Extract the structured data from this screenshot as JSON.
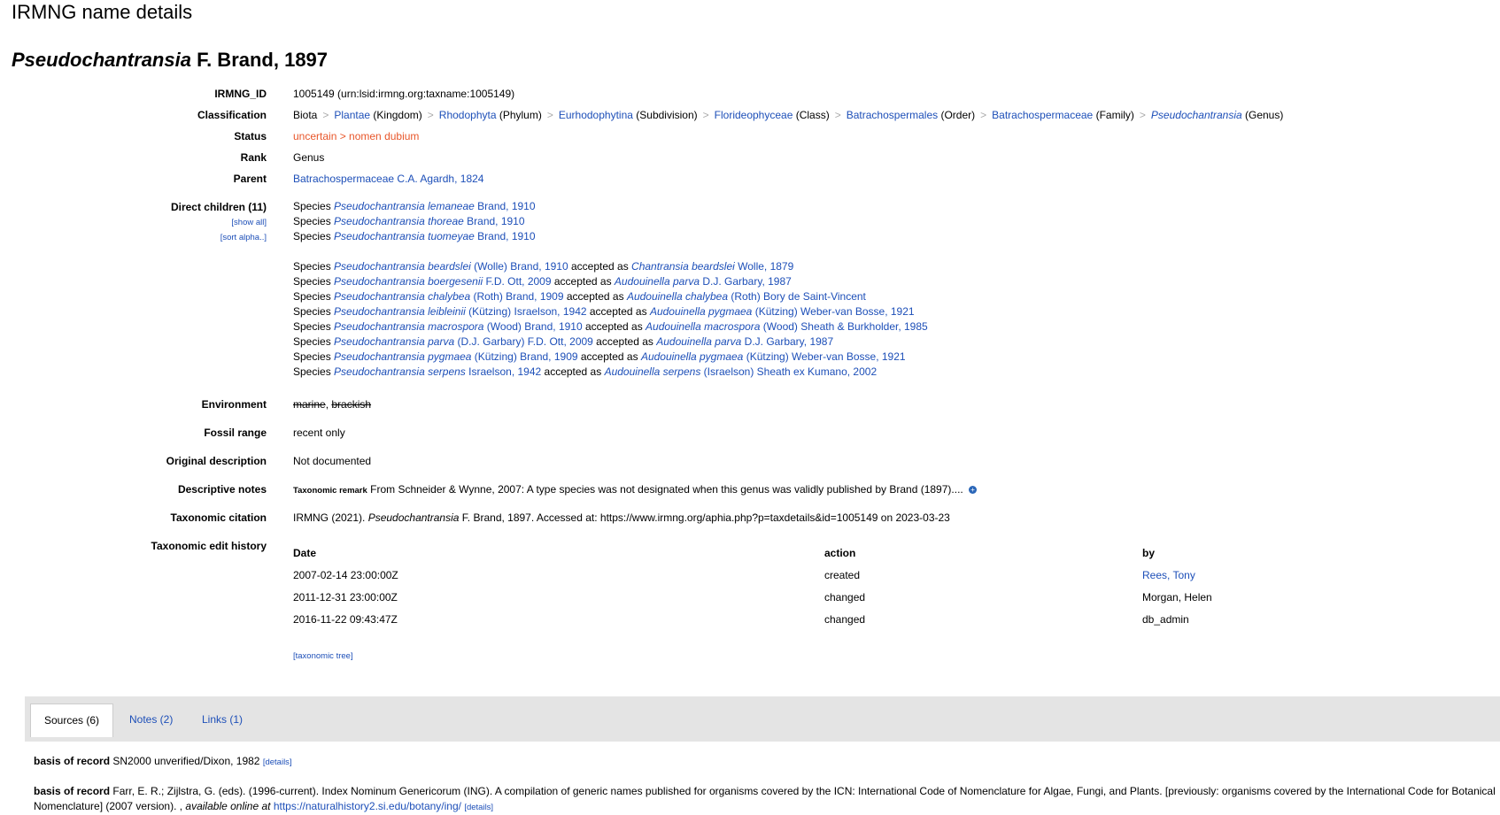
{
  "page_header": "IRMNG name details",
  "title": {
    "genus": "Pseudochantransia",
    "author": "F. Brand, 1897"
  },
  "irmng_id": {
    "label": "IRMNG_ID",
    "value": "1005149  (urn:lsid:irmng.org:taxname:1005149)"
  },
  "classification": {
    "label": "Classification",
    "items": [
      {
        "name": "Biota",
        "rank": "",
        "link": false
      },
      {
        "name": "Plantae",
        "rank": "(Kingdom)",
        "link": true
      },
      {
        "name": "Rhodophyta",
        "rank": "(Phylum)",
        "link": true
      },
      {
        "name": "Eurhodophytina",
        "rank": "(Subdivision)",
        "link": true
      },
      {
        "name": "Florideophyceae",
        "rank": "(Class)",
        "link": true
      },
      {
        "name": "Batrachospermales",
        "rank": "(Order)",
        "link": true
      },
      {
        "name": "Batrachospermaceae",
        "rank": "(Family)",
        "link": true
      },
      {
        "name": "Pseudochantransia",
        "rank": "(Genus)",
        "link": true,
        "italic": true
      }
    ],
    "separator": ">"
  },
  "status": {
    "label": "Status",
    "value": "uncertain > nomen dubium"
  },
  "rank": {
    "label": "Rank",
    "value": "Genus"
  },
  "parent": {
    "label": "Parent",
    "value": "Batrachospermaceae C.A. Agardh, 1824"
  },
  "children": {
    "label": "Direct children (11)",
    "show_all": "[show all]",
    "sort_alpha": "[sort alpha..]",
    "accepted": [
      {
        "rank": "Species",
        "name": "Pseudochantransia lemaneae",
        "author": "Brand, 1910"
      },
      {
        "rank": "Species",
        "name": "Pseudochantransia thoreae",
        "author": "Brand, 1910"
      },
      {
        "rank": "Species",
        "name": "Pseudochantransia tuomeyae",
        "author": "Brand, 1910"
      }
    ],
    "accepted_as_label": "accepted as",
    "synonyms": [
      {
        "rank": "Species",
        "name": "Pseudochantransia beardslei",
        "author": "(Wolle) Brand, 1910",
        "acc_name": "Chantransia beardslei",
        "acc_author": "Wolle, 1879"
      },
      {
        "rank": "Species",
        "name": "Pseudochantransia boergesenii",
        "author": "F.D. Ott, 2009",
        "acc_name": "Audouinella parva",
        "acc_author": "D.J. Garbary, 1987"
      },
      {
        "rank": "Species",
        "name": "Pseudochantransia chalybea",
        "author": "(Roth) Brand, 1909",
        "acc_name": "Audouinella chalybea",
        "acc_author": "(Roth) Bory de Saint-Vincent"
      },
      {
        "rank": "Species",
        "name": "Pseudochantransia leibleinii",
        "author": "(Kützing) Israelson, 1942",
        "acc_name": "Audouinella pygmaea",
        "acc_author": "(Kützing) Weber-van Bosse, 1921"
      },
      {
        "rank": "Species",
        "name": "Pseudochantransia macrospora",
        "author": "(Wood) Brand, 1910",
        "acc_name": "Audouinella macrospora",
        "acc_author": "(Wood) Sheath & Burkholder, 1985"
      },
      {
        "rank": "Species",
        "name": "Pseudochantransia parva",
        "author": "(D.J. Garbary) F.D. Ott, 2009",
        "acc_name": "Audouinella parva",
        "acc_author": "D.J. Garbary, 1987"
      },
      {
        "rank": "Species",
        "name": "Pseudochantransia pygmaea",
        "author": "(Kützing) Brand, 1909",
        "acc_name": "Audouinella pygmaea",
        "acc_author": "(Kützing) Weber-van Bosse, 1921"
      },
      {
        "rank": "Species",
        "name": "Pseudochantransia serpens",
        "author": "Israelson, 1942",
        "acc_name": "Audouinella serpens",
        "acc_author": "(Israelson) Sheath ex Kumano, 2002"
      }
    ]
  },
  "environment": {
    "label": "Environment",
    "marine": "marine",
    "comma": ", ",
    "brackish": "brackish"
  },
  "fossil_range": {
    "label": "Fossil range",
    "value": "recent only"
  },
  "original_description": {
    "label": "Original description",
    "value": "Not documented"
  },
  "descriptive_notes": {
    "label": "Descriptive notes",
    "tag": "Taxonomic remark",
    "text": "From Schneider & Wynne, 2007: A type species was not designated when this genus was validly published by Brand (1897)...."
  },
  "taxonomic_citation": {
    "label": "Taxonomic citation",
    "prefix": "IRMNG (2021).",
    "name": "Pseudochantransia",
    "suffix": "F. Brand, 1897. Accessed at: https://www.irmng.org/aphia.php?p=taxdetails&id=1005149 on 2023-03-23"
  },
  "edit_history": {
    "label": "Taxonomic edit history",
    "headers": [
      "Date",
      "action",
      "by"
    ],
    "rows": [
      {
        "date": "2007-02-14 23:00:00Z",
        "action": "created",
        "by": "Rees, Tony",
        "by_link": true
      },
      {
        "date": "2011-12-31 23:00:00Z",
        "action": "changed",
        "by": "Morgan, Helen",
        "by_link": false
      },
      {
        "date": "2016-11-22 09:43:47Z",
        "action": "changed",
        "by": "db_admin",
        "by_link": false
      }
    ]
  },
  "taxonomic_tree": "[taxonomic tree]",
  "tabs": [
    {
      "label": "Sources (6)",
      "active": true
    },
    {
      "label": "Notes (2)",
      "active": false
    },
    {
      "label": "Links (1)",
      "active": false
    }
  ],
  "sources": [
    {
      "type": "basis of record",
      "text": "SN2000 unverified/Dixon, 1982",
      "details": "[details]"
    },
    {
      "type": "basis of record",
      "text": "Farr, E. R.; Zijlstra, G. (eds). (1996-current). Index Nominum Genericorum (ING). A compilation of generic names published for organisms covered by the ICN: International Code of Nomenclature for Algae, Fungi, and Plants. [previously: organisms covered by the International Code for Botanical",
      "text2": "Nomenclature] (2007 version). ,",
      "available": "available online at",
      "url": "https://naturalhistory2.si.edu/botany/ing/",
      "details": "[details]"
    }
  ]
}
